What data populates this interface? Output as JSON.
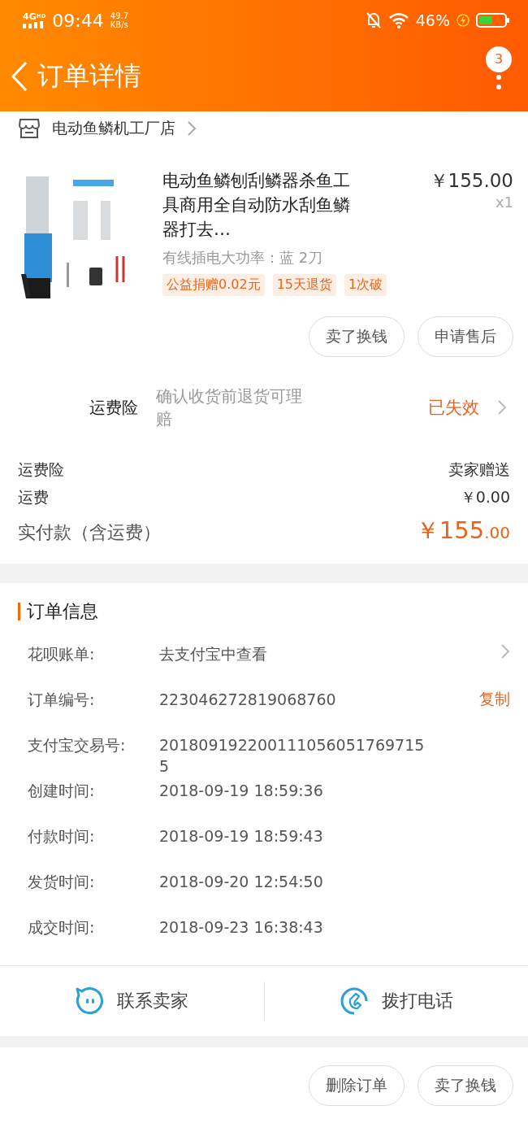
{
  "status_bar": {
    "network": "4G",
    "network_sub": "HD",
    "time": "09:44",
    "speed": "49.7",
    "speed_unit": "KB/s",
    "battery": "46%"
  },
  "nav": {
    "title": "订单详情",
    "badge": "3"
  },
  "shop": {
    "name": "电动鱼鳞机工厂店"
  },
  "product": {
    "title": "电动鱼鳞刨刮鳞器杀鱼工具商用全自动防水刮鱼鳞器打去…",
    "price": "￥155.00",
    "quantity": "x1",
    "spec": "有线插电大功率：蓝 2刀",
    "tags": [
      "公益捐赠0.02元",
      "15天退货",
      "1次破"
    ]
  },
  "product_buttons": [
    "卖了换钱",
    "申请售后"
  ],
  "insurance": {
    "label": "运费险",
    "description": "确认收货前退货可理赔",
    "status": "已失效"
  },
  "costs": [
    {
      "label": "运费险",
      "value": "卖家赠送",
      "kind": "plain"
    },
    {
      "label": "运费",
      "value": "￥0.00",
      "kind": "plain"
    },
    {
      "label": "实付款（含运费）",
      "value": "￥155",
      "value_decimal": ".00",
      "kind": "total"
    }
  ],
  "order_info": {
    "title": "订单信息",
    "rows": [
      {
        "label": "花呗账单:",
        "value": "去支付宝中查看",
        "kind": "link"
      },
      {
        "label": "订单编号:",
        "value": "223046272819068760",
        "action": "复制",
        "kind": "copy"
      },
      {
        "label": "支付宝交易号:",
        "value": "2018091922001110560517697155",
        "kind": "plain"
      },
      {
        "label": "创建时间:",
        "value": "2018-09-19 18:59:36",
        "kind": "plain"
      },
      {
        "label": "付款时间:",
        "value": "2018-09-19 18:59:43",
        "kind": "plain"
      },
      {
        "label": "发货时间:",
        "value": "2018-09-20 12:54:50",
        "kind": "plain"
      },
      {
        "label": "成交时间:",
        "value": "2018-09-23 16:38:43",
        "kind": "plain"
      }
    ]
  },
  "contact": [
    {
      "label": "联系卖家",
      "kind": "chat"
    },
    {
      "label": "拨打电话",
      "kind": "phone"
    }
  ],
  "bottom_buttons": [
    "删除订单",
    "卖了换钱"
  ]
}
